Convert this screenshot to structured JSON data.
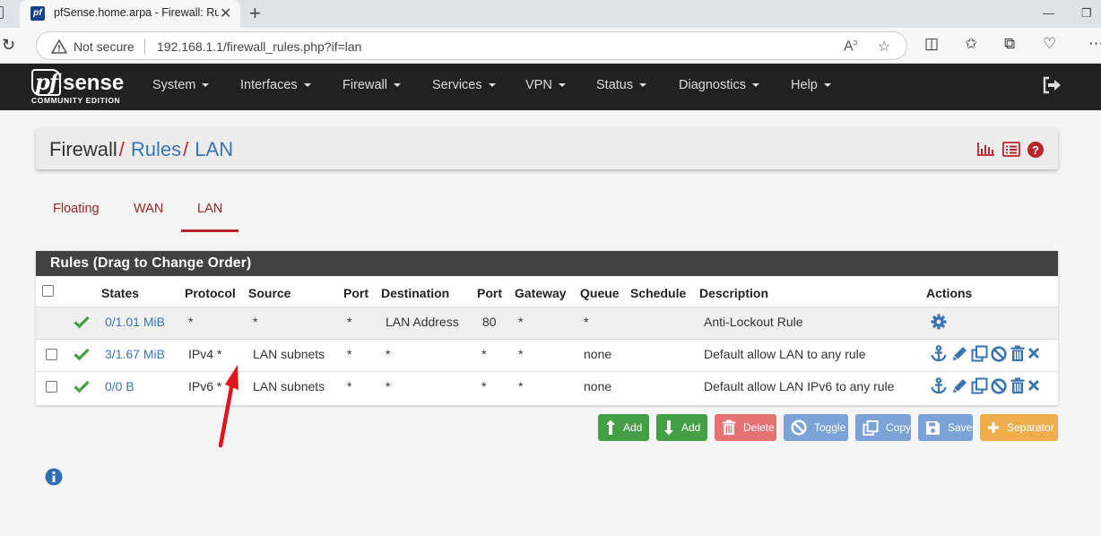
{
  "browser": {
    "tab_title": "pfSense.home.arpa - Firewall: Rules: LAN",
    "favicon_text": "pf",
    "security_label": "Not secure",
    "url": "192.168.1.1/firewall_rules.php?if=lan"
  },
  "navbar": {
    "logo_pf": "pf",
    "logo_sense": "sense",
    "logo_sub": "COMMUNITY EDITION",
    "items": [
      {
        "label": "System"
      },
      {
        "label": "Interfaces"
      },
      {
        "label": "Firewall"
      },
      {
        "label": "Services"
      },
      {
        "label": "VPN"
      },
      {
        "label": "Status"
      },
      {
        "label": "Diagnostics"
      },
      {
        "label": "Help"
      }
    ]
  },
  "breadcrumb": {
    "root": "Firewall",
    "level1": "Rules",
    "level2": "LAN",
    "separator": "/"
  },
  "tabs": [
    {
      "label": "Floating"
    },
    {
      "label": "WAN"
    },
    {
      "label": "LAN",
      "active": true
    }
  ],
  "rules_panel": {
    "title": "Rules (Drag to Change Order)",
    "columns": [
      "States",
      "Protocol",
      "Source",
      "Port",
      "Destination",
      "Port",
      "Gateway",
      "Queue",
      "Schedule",
      "Description",
      "Actions"
    ],
    "rows": [
      {
        "states": "0/1.01 MiB",
        "protocol": "*",
        "source": "*",
        "src_port": "*",
        "destination": "LAN Address",
        "dst_port": "80",
        "gateway": "*",
        "queue": "*",
        "schedule": "",
        "description": "Anti-Lockout Rule"
      },
      {
        "states": "3/1.67 MiB",
        "protocol": "IPv4 *",
        "source": "LAN subnets",
        "src_port": "*",
        "destination": "*",
        "dst_port": "*",
        "gateway": "*",
        "queue": "none",
        "schedule": "",
        "description": "Default allow LAN to any rule"
      },
      {
        "states": "0/0 B",
        "protocol": "IPv6 *",
        "source": "LAN subnets",
        "src_port": "*",
        "destination": "*",
        "dst_port": "*",
        "gateway": "*",
        "queue": "none",
        "schedule": "",
        "description": "Default allow LAN IPv6 to any rule"
      }
    ]
  },
  "buttons": {
    "add_top": "Add",
    "add_bottom": "Add",
    "delete": "Delete",
    "toggle": "Toggle",
    "copy": "Copy",
    "save": "Save",
    "separator": "Separator"
  },
  "colors": {
    "navbar_bg": "#212121",
    "panel_header_bg": "#424242",
    "accent_red": "#b8262c",
    "link_blue": "#3a74b0",
    "success_green": "#43a047",
    "danger_red": "#e57373",
    "info_blue": "#7ba3d8",
    "warning_orange": "#f0ad4e"
  }
}
